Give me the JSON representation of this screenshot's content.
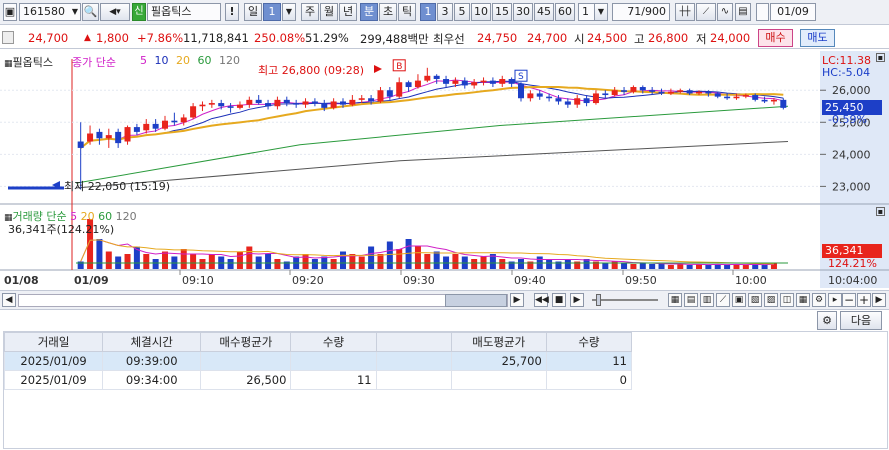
{
  "toolbar": {
    "code": "161580",
    "credit_badge": "신",
    "stock_name": "필옵틱스",
    "warn": "!",
    "period_buttons": [
      "일",
      "주",
      "월",
      "년",
      "분",
      "초",
      "틱"
    ],
    "period_selected": "분",
    "day_count": "1",
    "minute_buttons": [
      "1",
      "3",
      "5",
      "10",
      "15",
      "30",
      "45",
      "60"
    ],
    "minute_selected": "1",
    "unit_value": "1",
    "page_count": "71/900",
    "date": "01/09"
  },
  "quote": {
    "price": "24,700",
    "change": "1,800",
    "change_pct": "+7.86%",
    "volume": "11,718,841",
    "vol_ratio": "250.08%",
    "strength": "51.29%",
    "amount": "299,488백만",
    "best_label": "최우선",
    "ask": "24,750",
    "bid": "24,700",
    "open_label": "시",
    "open": "24,500",
    "high_label": "고",
    "high": "26,800",
    "low_label": "저",
    "low": "24,000",
    "buy_btn": "매수",
    "sell_btn": "매도"
  },
  "chart": {
    "title": "필옵틱스",
    "ma_label": "종가 단순",
    "ma_periods": [
      "5",
      "10",
      "20",
      "60",
      "120"
    ],
    "lc": "LC:11.38",
    "hc": "HC:-5.04",
    "high_annot": "최고 26,800 (09:28)",
    "low_annot": "최저 22,050 (15:19)",
    "current_price": "25,450",
    "current_pct": "-0.59%",
    "y_ticks": [
      "26,000",
      "25,000",
      "24,000",
      "23,000"
    ],
    "vol_label": "거래량 단순",
    "vol_periods": [
      "5",
      "20",
      "60",
      "120"
    ],
    "vol_info": "36,341주(124.21%)",
    "vol_current": "36,341",
    "vol_pct": "124.21%",
    "x_labels": [
      "01/08",
      "01/09",
      "09:10",
      "09:20",
      "09:30",
      "09:40",
      "09:50",
      "10:00",
      "10:04:00"
    ],
    "buy_marker": "B",
    "sell_marker": "S",
    "colors": {
      "up": "#e8241c",
      "down": "#1d3fc7",
      "ma5": "#d020c8",
      "ma10": "#1b2fb8",
      "ma20": "#e6a91f",
      "ma60": "#2a9a3c",
      "ma120": "#555555"
    }
  },
  "chart_data": {
    "type": "candlestick",
    "price_ylim": [
      22700,
      26600
    ],
    "candles": [
      {
        "o": 24400,
        "c": 24200,
        "h": 25000,
        "l": 22900
      },
      {
        "o": 24400,
        "c": 24650,
        "h": 24900,
        "l": 24300
      },
      {
        "o": 24700,
        "c": 24500,
        "h": 24800,
        "l": 24300
      },
      {
        "o": 24500,
        "c": 24600,
        "h": 24800,
        "l": 24200
      },
      {
        "o": 24700,
        "c": 24350,
        "h": 24800,
        "l": 24200
      },
      {
        "o": 24400,
        "c": 24850,
        "h": 24900,
        "l": 24300
      },
      {
        "o": 24850,
        "c": 24700,
        "h": 24950,
        "l": 24600
      },
      {
        "o": 24750,
        "c": 24950,
        "h": 25100,
        "l": 24650
      },
      {
        "o": 24950,
        "c": 24800,
        "h": 25100,
        "l": 24700
      },
      {
        "o": 24800,
        "c": 25050,
        "h": 25200,
        "l": 24750
      },
      {
        "o": 25050,
        "c": 25000,
        "h": 25300,
        "l": 24900
      },
      {
        "o": 25000,
        "c": 25150,
        "h": 25250,
        "l": 24900
      },
      {
        "o": 25150,
        "c": 25500,
        "h": 25600,
        "l": 25100
      },
      {
        "o": 25500,
        "c": 25550,
        "h": 25650,
        "l": 25350
      },
      {
        "o": 25550,
        "c": 25600,
        "h": 25700,
        "l": 25450
      },
      {
        "o": 25600,
        "c": 25500,
        "h": 25700,
        "l": 25400
      },
      {
        "o": 25500,
        "c": 25450,
        "h": 25600,
        "l": 25300
      },
      {
        "o": 25450,
        "c": 25550,
        "h": 25650,
        "l": 25400
      },
      {
        "o": 25550,
        "c": 25700,
        "h": 25800,
        "l": 25450
      },
      {
        "o": 25700,
        "c": 25600,
        "h": 25850,
        "l": 25550
      },
      {
        "o": 25600,
        "c": 25500,
        "h": 25700,
        "l": 25400
      },
      {
        "o": 25500,
        "c": 25700,
        "h": 25800,
        "l": 25400
      },
      {
        "o": 25700,
        "c": 25600,
        "h": 25800,
        "l": 25500
      },
      {
        "o": 25600,
        "c": 25550,
        "h": 25700,
        "l": 25450
      },
      {
        "o": 25550,
        "c": 25650,
        "h": 25750,
        "l": 25450
      },
      {
        "o": 25650,
        "c": 25600,
        "h": 25750,
        "l": 25500
      },
      {
        "o": 25600,
        "c": 25450,
        "h": 25700,
        "l": 25350
      },
      {
        "o": 25450,
        "c": 25650,
        "h": 25750,
        "l": 25400
      },
      {
        "o": 25650,
        "c": 25550,
        "h": 25750,
        "l": 25450
      },
      {
        "o": 25550,
        "c": 25700,
        "h": 25850,
        "l": 25500
      },
      {
        "o": 25700,
        "c": 25750,
        "h": 25850,
        "l": 25600
      },
      {
        "o": 25750,
        "c": 25650,
        "h": 25850,
        "l": 25550
      },
      {
        "o": 25650,
        "c": 26000,
        "h": 26100,
        "l": 25600
      },
      {
        "o": 26000,
        "c": 25800,
        "h": 26100,
        "l": 25700
      },
      {
        "o": 25800,
        "c": 26250,
        "h": 26400,
        "l": 25750
      },
      {
        "o": 26250,
        "c": 26100,
        "h": 26300,
        "l": 25950
      },
      {
        "o": 26100,
        "c": 26300,
        "h": 26500,
        "l": 26050
      },
      {
        "o": 26300,
        "c": 26450,
        "h": 26700,
        "l": 26250
      },
      {
        "o": 26450,
        "c": 26350,
        "h": 26500,
        "l": 26200
      },
      {
        "o": 26350,
        "c": 26200,
        "h": 26450,
        "l": 26100
      },
      {
        "o": 26200,
        "c": 26300,
        "h": 26400,
        "l": 26100
      },
      {
        "o": 26300,
        "c": 26150,
        "h": 26400,
        "l": 26050
      },
      {
        "o": 26150,
        "c": 26250,
        "h": 26350,
        "l": 26050
      },
      {
        "o": 26250,
        "c": 26300,
        "h": 26400,
        "l": 26150
      },
      {
        "o": 26300,
        "c": 26200,
        "h": 26400,
        "l": 26100
      },
      {
        "o": 26200,
        "c": 26350,
        "h": 26450,
        "l": 26100
      },
      {
        "o": 26350,
        "c": 26200,
        "h": 26400,
        "l": 26100
      },
      {
        "o": 26200,
        "c": 25750,
        "h": 26250,
        "l": 25650
      },
      {
        "o": 25750,
        "c": 25900,
        "h": 26000,
        "l": 25650
      },
      {
        "o": 25900,
        "c": 25800,
        "h": 26000,
        "l": 25700
      },
      {
        "o": 25800,
        "c": 25750,
        "h": 25900,
        "l": 25650
      },
      {
        "o": 25750,
        "c": 25650,
        "h": 25850,
        "l": 25550
      },
      {
        "o": 25650,
        "c": 25550,
        "h": 25750,
        "l": 25450
      },
      {
        "o": 25550,
        "c": 25750,
        "h": 25850,
        "l": 25450
      },
      {
        "o": 25750,
        "c": 25600,
        "h": 25850,
        "l": 25500
      },
      {
        "o": 25600,
        "c": 25900,
        "h": 26000,
        "l": 25550
      },
      {
        "o": 25900,
        "c": 25850,
        "h": 26000,
        "l": 25750
      },
      {
        "o": 25850,
        "c": 26000,
        "h": 26100,
        "l": 25800
      },
      {
        "o": 26000,
        "c": 25950,
        "h": 26100,
        "l": 25850
      },
      {
        "o": 25950,
        "c": 26100,
        "h": 26150,
        "l": 25900
      },
      {
        "o": 26100,
        "c": 26000,
        "h": 26150,
        "l": 25900
      },
      {
        "o": 26000,
        "c": 25950,
        "h": 26100,
        "l": 25850
      },
      {
        "o": 25950,
        "c": 25900,
        "h": 26050,
        "l": 25850
      },
      {
        "o": 25900,
        "c": 25950,
        "h": 26050,
        "l": 25850
      },
      {
        "o": 25950,
        "c": 26000,
        "h": 26050,
        "l": 25900
      },
      {
        "o": 26000,
        "c": 25900,
        "h": 26050,
        "l": 25850
      },
      {
        "o": 25900,
        "c": 25950,
        "h": 26000,
        "l": 25850
      },
      {
        "o": 25950,
        "c": 25900,
        "h": 26000,
        "l": 25800
      },
      {
        "o": 25900,
        "c": 25800,
        "h": 25950,
        "l": 25750
      },
      {
        "o": 25800,
        "c": 25750,
        "h": 25900,
        "l": 25700
      },
      {
        "o": 25750,
        "c": 25800,
        "h": 25900,
        "l": 25700
      },
      {
        "o": 25800,
        "c": 25850,
        "h": 25900,
        "l": 25750
      },
      {
        "o": 25850,
        "c": 25700,
        "h": 25900,
        "l": 25650
      },
      {
        "o": 25700,
        "c": 25650,
        "h": 25800,
        "l": 25600
      },
      {
        "o": 25650,
        "c": 25700,
        "h": 25750,
        "l": 25550
      },
      {
        "o": 25700,
        "c": 25450,
        "h": 25750,
        "l": 25400
      }
    ],
    "volumes": [
      0.15,
      1.0,
      0.6,
      0.35,
      0.25,
      0.3,
      0.45,
      0.3,
      0.2,
      0.35,
      0.25,
      0.4,
      0.3,
      0.2,
      0.3,
      0.25,
      0.2,
      0.35,
      0.45,
      0.25,
      0.3,
      0.2,
      0.15,
      0.25,
      0.3,
      0.2,
      0.25,
      0.2,
      0.35,
      0.3,
      0.25,
      0.45,
      0.3,
      0.55,
      0.4,
      0.6,
      0.45,
      0.3,
      0.35,
      0.25,
      0.3,
      0.25,
      0.2,
      0.25,
      0.3,
      0.2,
      0.15,
      0.2,
      0.15,
      0.25,
      0.2,
      0.15,
      0.2,
      0.15,
      0.2,
      0.15,
      0.12,
      0.15,
      0.12,
      0.1,
      0.12,
      0.1,
      0.1,
      0.08,
      0.1,
      0.08,
      0.1,
      0.08,
      0.1,
      0.08,
      0.1,
      0.08,
      0.1,
      0.08,
      0.12
    ]
  },
  "scroll": {
    "prev": "◀",
    "next": "▶",
    "minus": "−",
    "plus": "+"
  },
  "bottom": {
    "next_btn": "다음",
    "headers": [
      "거래일",
      "체결시간",
      "매수평균가",
      "수량",
      "",
      "매도평균가",
      "수량"
    ],
    "rows": [
      [
        "2025/01/09",
        "09:39:00",
        "",
        "",
        "",
        "25,700",
        "11"
      ],
      [
        "2025/01/09",
        "09:34:00",
        "26,500",
        "11",
        "",
        "",
        "0"
      ]
    ]
  }
}
